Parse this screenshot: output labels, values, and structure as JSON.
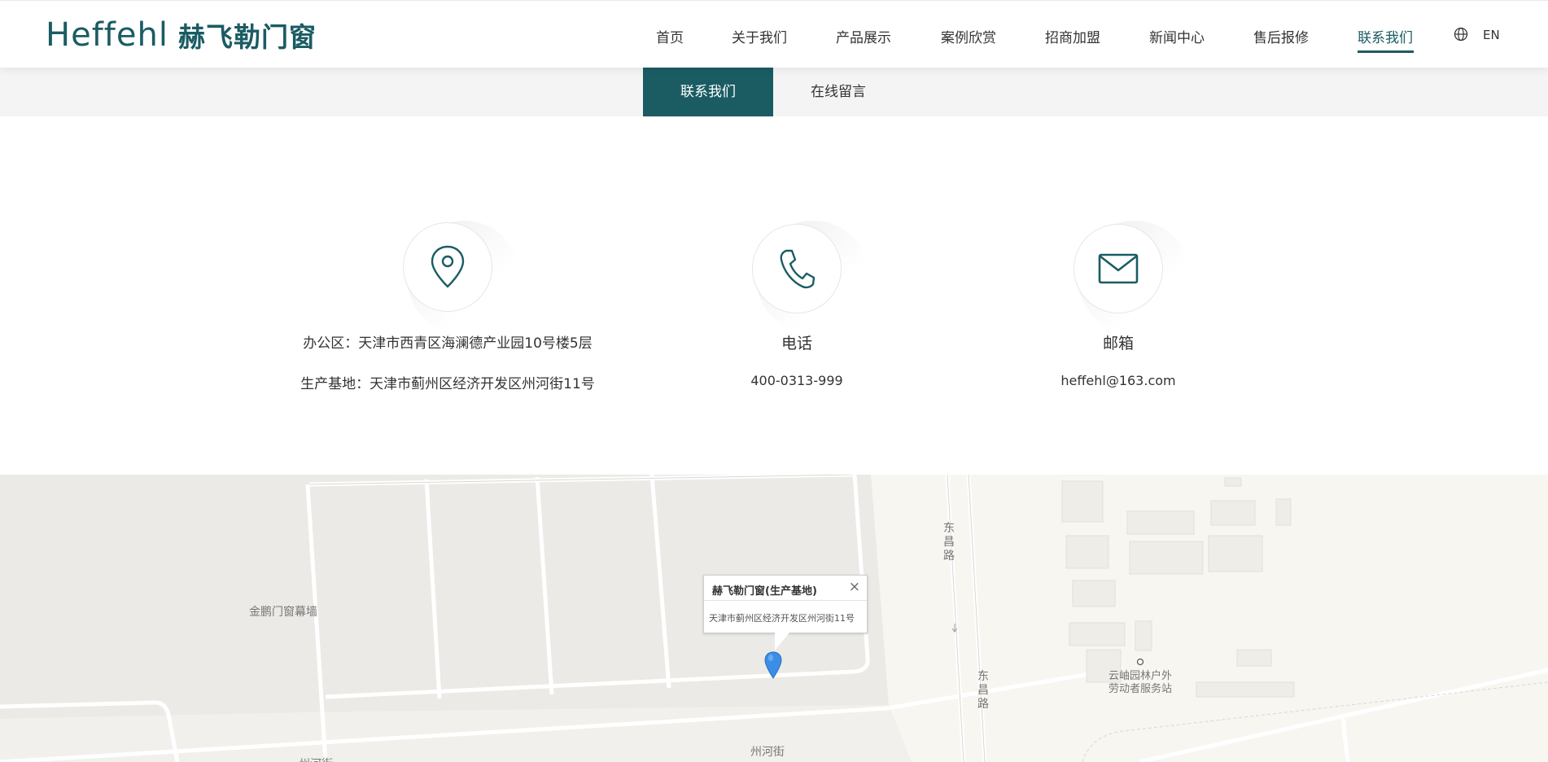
{
  "header": {
    "logo_en": "Heffehl",
    "logo_cn": "赫飞勒门窗",
    "nav": [
      {
        "label": "首页",
        "active": false
      },
      {
        "label": "关于我们",
        "active": false
      },
      {
        "label": "产品展示",
        "active": false
      },
      {
        "label": "案例欣赏",
        "active": false
      },
      {
        "label": "招商加盟",
        "active": false
      },
      {
        "label": "新闻中心",
        "active": false
      },
      {
        "label": "售后报修",
        "active": false
      },
      {
        "label": "联系我们",
        "active": true
      }
    ],
    "lang_label": "EN",
    "lang_icon": "globe-icon"
  },
  "subnav": {
    "tabs": [
      {
        "label": "联系我们",
        "active": true
      },
      {
        "label": "在线留言",
        "active": false
      }
    ]
  },
  "contact": {
    "address": {
      "icon": "location-pin-icon",
      "office": "办公区：天津市西青区海澜德产业园10号楼5层",
      "factory": "生产基地：天津市蓟州区经济开发区州河街11号"
    },
    "phone": {
      "icon": "phone-icon",
      "title": "电话",
      "value": "400-0313-999"
    },
    "email": {
      "icon": "envelope-icon",
      "title": "邮箱",
      "value": "heffehl@163.com"
    }
  },
  "map": {
    "popup_title": "赫飞勒门窗(生产基地)",
    "popup_address": "天津市蓟州区经济开发区州河街11号",
    "close_symbol": "×",
    "labels": {
      "poi_left": "金鹏门窗幕墙",
      "road_east_top": "东昌路",
      "road_east_bottom": "东昌路",
      "road_south": "州河街",
      "road_south_left": "州河街",
      "poi_right_line1": "云岫园林户外",
      "poi_right_line2": "劳动者服务站"
    },
    "colors": {
      "accent": "#1b5c63",
      "marker": "#3a8ee6"
    }
  }
}
